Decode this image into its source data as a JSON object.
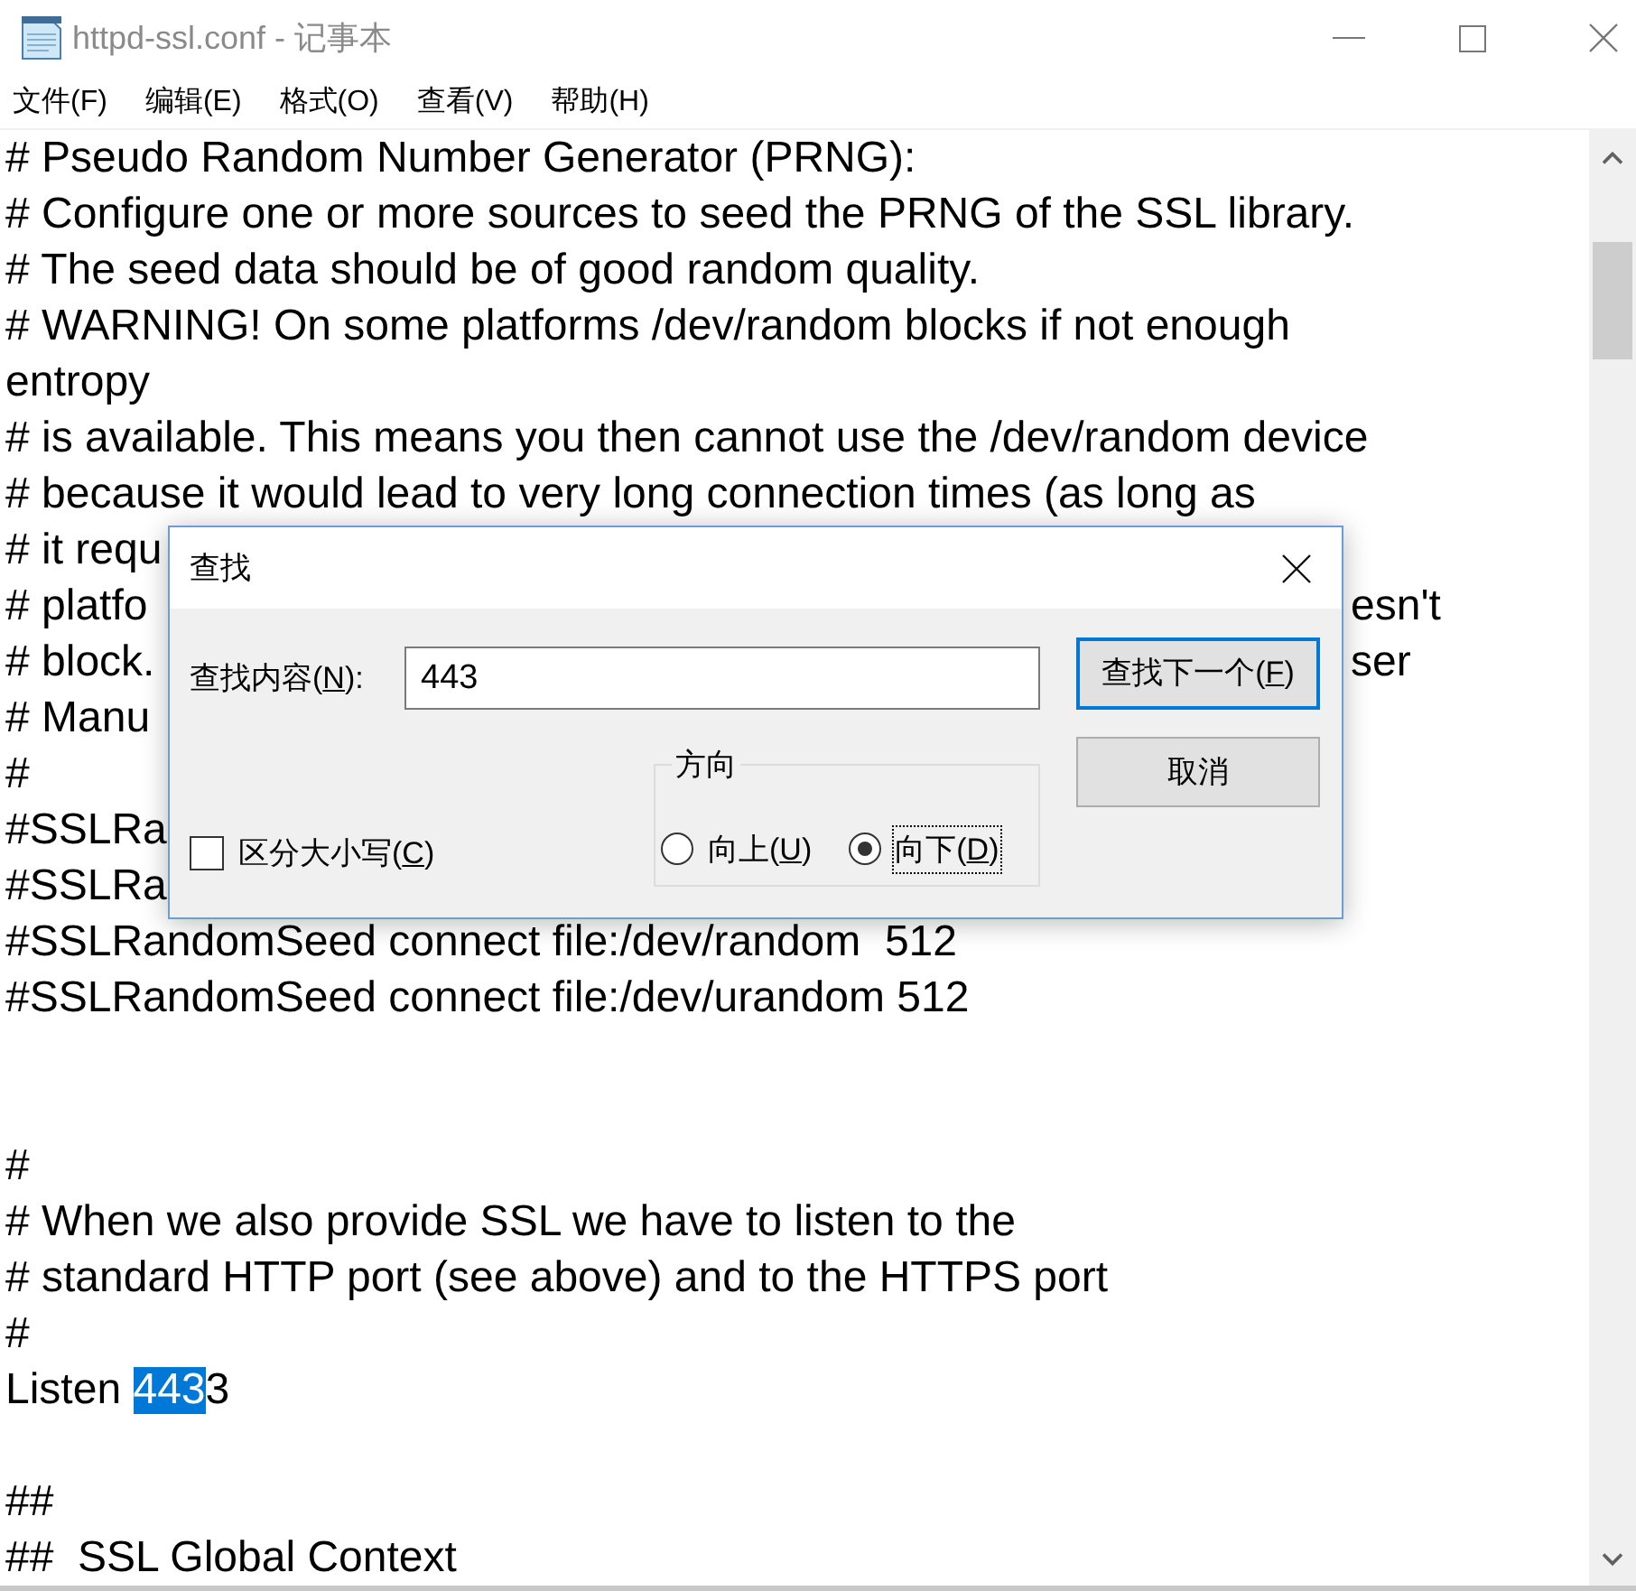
{
  "window": {
    "title": "httpd-ssl.conf - 记事本"
  },
  "menu_bar": [
    "文件(F)",
    "编辑(E)",
    "格式(O)",
    "查看(V)",
    "帮助(H)"
  ],
  "editor": {
    "lines": [
      {
        "kind": "text",
        "text": "# Pseudo Random Number Generator (PRNG):"
      },
      {
        "kind": "text",
        "text": "# Configure one or more sources to seed the PRNG of the SSL library."
      },
      {
        "kind": "text",
        "text": "# The seed data should be of good random quality."
      },
      {
        "kind": "text",
        "text": "# WARNING! On some platforms /dev/random blocks if not enough"
      },
      {
        "kind": "text",
        "text": "entropy"
      },
      {
        "kind": "text",
        "text": "# is available. This means you then cannot use the /dev/random device"
      },
      {
        "kind": "text",
        "text": "# because it would lead to very long connection times (as long as"
      },
      {
        "kind": "text",
        "text": "# it requ"
      },
      {
        "kind": "split",
        "text": "# platfo",
        "text_right": "esn't"
      },
      {
        "kind": "split",
        "text": "# block.",
        "text_right": "ser"
      },
      {
        "kind": "text",
        "text": "# Manu"
      },
      {
        "kind": "text",
        "text": "#"
      },
      {
        "kind": "text",
        "text": "#SSLRa"
      },
      {
        "kind": "text",
        "text": "#SSLRa"
      },
      {
        "kind": "text",
        "text": "#SSLRandomSeed connect file:/dev/random  512"
      },
      {
        "kind": "text",
        "text": "#SSLRandomSeed connect file:/dev/urandom 512"
      },
      {
        "kind": "blank"
      },
      {
        "kind": "blank"
      },
      {
        "kind": "text",
        "text": "#"
      },
      {
        "kind": "text",
        "text": "# When we also provide SSL we have to listen to the"
      },
      {
        "kind": "text",
        "text": "# standard HTTP port (see above) and to the HTTPS port"
      },
      {
        "kind": "text",
        "text": "#"
      },
      {
        "kind": "selection",
        "parts": [
          {
            "text": "Listen ",
            "selected": false
          },
          {
            "text": "443",
            "selected": true
          },
          {
            "text": "3",
            "selected": false
          }
        ]
      },
      {
        "kind": "blank"
      },
      {
        "kind": "text",
        "text": "##"
      },
      {
        "kind": "text",
        "text": "##  SSL Global Context"
      }
    ]
  },
  "find_dialog": {
    "title": "查找",
    "find_label": "查找内容(N):",
    "search": {
      "value": "443"
    },
    "buttons": [
      {
        "label": "查找下一个(F)",
        "default": true
      },
      {
        "label": "取消",
        "default": false
      }
    ],
    "direction": {
      "label": "方向",
      "options": [
        {
          "label": "向上(U)",
          "selected": false,
          "focused": false
        },
        {
          "label": "向下(D)",
          "selected": true,
          "focused": true
        }
      ]
    },
    "match_case": {
      "label": "区分大小写(C)",
      "checked": false
    }
  }
}
